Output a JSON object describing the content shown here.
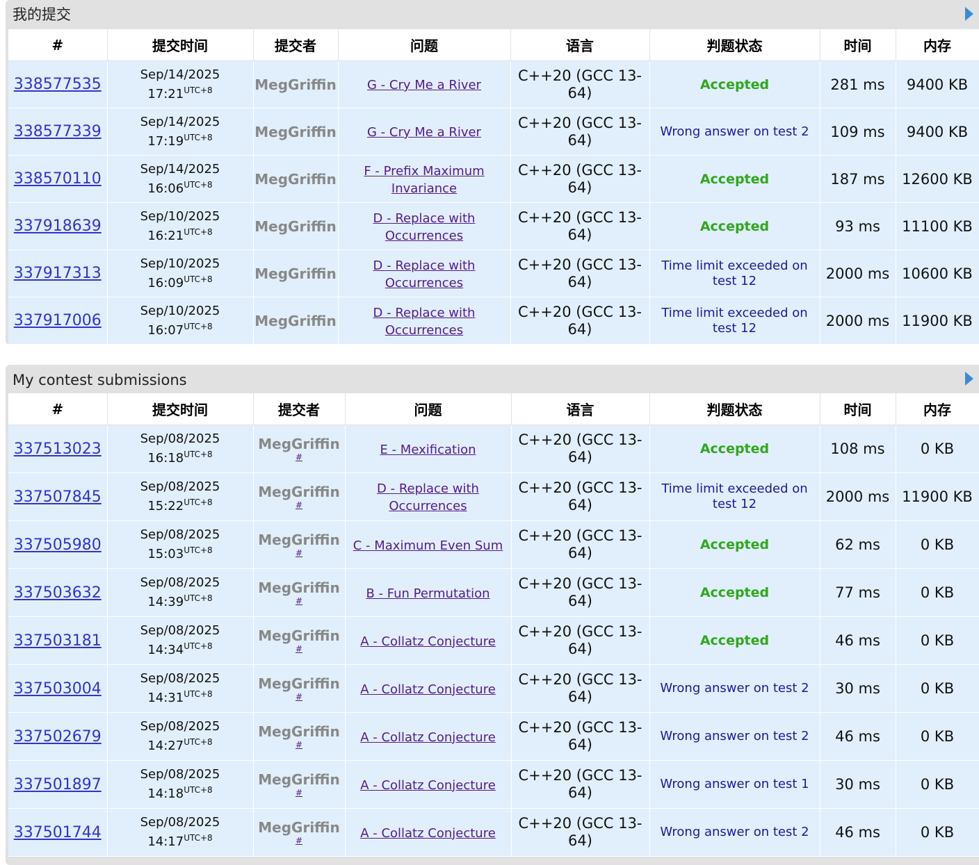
{
  "panel1": {
    "title": "我的提交",
    "headers": [
      "#",
      "提交时间",
      "提交者",
      "问题",
      "语言",
      "判题状态",
      "时间",
      "内存"
    ],
    "rows": [
      {
        "id": "338577535",
        "date": "Sep/14/2025",
        "time": "17:21",
        "tz": "UTC+8",
        "author": "MegGriffin",
        "problem": "G - Cry Me a River",
        "lang": "C++20 (GCC 13-64)",
        "verdict": "Accepted",
        "ok": true,
        "ms": "281 ms",
        "mem": "9400 KB"
      },
      {
        "id": "338577339",
        "date": "Sep/14/2025",
        "time": "17:19",
        "tz": "UTC+8",
        "author": "MegGriffin",
        "problem": "G - Cry Me a River",
        "lang": "C++20 (GCC 13-64)",
        "verdict": "Wrong answer on test 2",
        "ok": false,
        "ms": "109 ms",
        "mem": "9400 KB"
      },
      {
        "id": "338570110",
        "date": "Sep/14/2025",
        "time": "16:06",
        "tz": "UTC+8",
        "author": "MegGriffin",
        "problem": "F - Prefix Maximum Invariance",
        "lang": "C++20 (GCC 13-64)",
        "verdict": "Accepted",
        "ok": true,
        "ms": "187 ms",
        "mem": "12600 KB"
      },
      {
        "id": "337918639",
        "date": "Sep/10/2025",
        "time": "16:21",
        "tz": "UTC+8",
        "author": "MegGriffin",
        "problem": "D - Replace with Occurrences",
        "lang": "C++20 (GCC 13-64)",
        "verdict": "Accepted",
        "ok": true,
        "ms": "93 ms",
        "mem": "11100 KB"
      },
      {
        "id": "337917313",
        "date": "Sep/10/2025",
        "time": "16:09",
        "tz": "UTC+8",
        "author": "MegGriffin",
        "problem": "D - Replace with Occurrences",
        "lang": "C++20 (GCC 13-64)",
        "verdict": "Time limit exceeded on test 12",
        "ok": false,
        "ms": "2000 ms",
        "mem": "10600 KB"
      },
      {
        "id": "337917006",
        "date": "Sep/10/2025",
        "time": "16:07",
        "tz": "UTC+8",
        "author": "MegGriffin",
        "problem": "D - Replace with Occurrences",
        "lang": "C++20 (GCC 13-64)",
        "verdict": "Time limit exceeded on test 12",
        "ok": false,
        "ms": "2000 ms",
        "mem": "11900 KB"
      }
    ]
  },
  "panel2": {
    "title": "My contest submissions",
    "headers": [
      "#",
      "提交时间",
      "提交者",
      "问题",
      "语言",
      "判题状态",
      "时间",
      "内存"
    ],
    "rows": [
      {
        "id": "337513023",
        "date": "Sep/08/2025",
        "time": "16:18",
        "tz": "UTC+8",
        "author": "MegGriffin",
        "hash": "#",
        "problem": "E - Mexification",
        "lang": "C++20 (GCC 13-64)",
        "verdict": "Accepted",
        "ok": true,
        "ms": "108 ms",
        "mem": "0 KB"
      },
      {
        "id": "337507845",
        "date": "Sep/08/2025",
        "time": "15:22",
        "tz": "UTC+8",
        "author": "MegGriffin",
        "hash": "#",
        "problem": "D - Replace with Occurrences",
        "lang": "C++20 (GCC 13-64)",
        "verdict": "Time limit exceeded on test 12",
        "ok": false,
        "ms": "2000 ms",
        "mem": "11900 KB"
      },
      {
        "id": "337505980",
        "date": "Sep/08/2025",
        "time": "15:03",
        "tz": "UTC+8",
        "author": "MegGriffin",
        "hash": "#",
        "problem": "C - Maximum Even Sum",
        "lang": "C++20 (GCC 13-64)",
        "verdict": "Accepted",
        "ok": true,
        "ms": "62 ms",
        "mem": "0 KB"
      },
      {
        "id": "337503632",
        "date": "Sep/08/2025",
        "time": "14:39",
        "tz": "UTC+8",
        "author": "MegGriffin",
        "hash": "#",
        "problem": "B - Fun Permutation",
        "lang": "C++20 (GCC 13-64)",
        "verdict": "Accepted",
        "ok": true,
        "ms": "77 ms",
        "mem": "0 KB"
      },
      {
        "id": "337503181",
        "date": "Sep/08/2025",
        "time": "14:34",
        "tz": "UTC+8",
        "author": "MegGriffin",
        "hash": "#",
        "problem": "A - Collatz Conjecture",
        "lang": "C++20 (GCC 13-64)",
        "verdict": "Accepted",
        "ok": true,
        "ms": "46 ms",
        "mem": "0 KB"
      },
      {
        "id": "337503004",
        "date": "Sep/08/2025",
        "time": "14:31",
        "tz": "UTC+8",
        "author": "MegGriffin",
        "hash": "#",
        "problem": "A - Collatz Conjecture",
        "lang": "C++20 (GCC 13-64)",
        "verdict": "Wrong answer on test 2",
        "ok": false,
        "ms": "30 ms",
        "mem": "0 KB"
      },
      {
        "id": "337502679",
        "date": "Sep/08/2025",
        "time": "14:27",
        "tz": "UTC+8",
        "author": "MegGriffin",
        "hash": "#",
        "problem": "A - Collatz Conjecture",
        "lang": "C++20 (GCC 13-64)",
        "verdict": "Wrong answer on test 2",
        "ok": false,
        "ms": "46 ms",
        "mem": "0 KB"
      },
      {
        "id": "337501897",
        "date": "Sep/08/2025",
        "time": "14:18",
        "tz": "UTC+8",
        "author": "MegGriffin",
        "hash": "#",
        "problem": "A - Collatz Conjecture",
        "lang": "C++20 (GCC 13-64)",
        "verdict": "Wrong answer on test 1",
        "ok": false,
        "ms": "30 ms",
        "mem": "0 KB"
      },
      {
        "id": "337501744",
        "date": "Sep/08/2025",
        "time": "14:17",
        "tz": "UTC+8",
        "author": "MegGriffin",
        "hash": "#",
        "problem": "A - Collatz Conjecture",
        "lang": "C++20 (GCC 13-64)",
        "verdict": "Wrong answer on test 2",
        "ok": false,
        "ms": "46 ms",
        "mem": "0 KB"
      }
    ]
  }
}
